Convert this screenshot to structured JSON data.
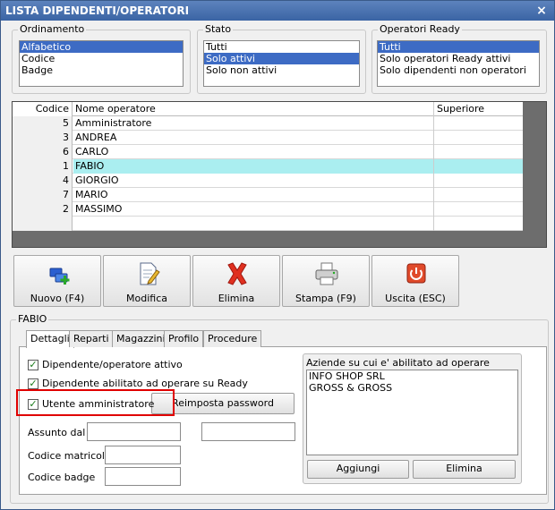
{
  "window": {
    "title": "LISTA DIPENDENTI/OPERATORI",
    "close": "×"
  },
  "ordinamento": {
    "title": "Ordinamento",
    "items": [
      "Alfabetico",
      "Codice",
      "Badge"
    ],
    "selected": 0
  },
  "stato": {
    "title": "Stato",
    "items": [
      "Tutti",
      "Solo attivi",
      "Solo non attivi"
    ],
    "selected": 1
  },
  "operatori_ready": {
    "title": "Operatori Ready",
    "items": [
      "Tutti",
      "Solo operatori Ready attivi",
      "Solo dipendenti non operatori"
    ],
    "selected": 0
  },
  "grid": {
    "headers": {
      "code": "Codice",
      "name": "Nome operatore",
      "superior": "Superiore"
    },
    "rows": [
      {
        "code": "5",
        "name": "Amministratore",
        "superior": ""
      },
      {
        "code": "3",
        "name": "ANDREA",
        "superior": ""
      },
      {
        "code": "6",
        "name": "CARLO",
        "superior": ""
      },
      {
        "code": "1",
        "name": "FABIO",
        "superior": "",
        "selected": true
      },
      {
        "code": "4",
        "name": "GIORGIO",
        "superior": ""
      },
      {
        "code": "7",
        "name": "MARIO",
        "superior": ""
      },
      {
        "code": "2",
        "name": "MASSIMO",
        "superior": ""
      },
      {
        "code": "",
        "name": "",
        "superior": ""
      }
    ]
  },
  "toolbar": {
    "nuovo": "Nuovo (F4)",
    "modifica": "Modifica",
    "elimina": "Elimina",
    "stampa": "Stampa (F9)",
    "uscita": "Uscita (ESC)"
  },
  "detail": {
    "group_title": "FABIO",
    "tabs": [
      "Dettagli",
      "Reparti",
      "Magazzini",
      "Profilo",
      "Procedure"
    ],
    "active_tab": 0,
    "chk_attivo": "Dipendente/operatore attivo",
    "chk_ready": "Dipendente abilitato ad operare su Ready",
    "chk_admin": "Utente amministratore",
    "reset_password": "Reimposta password",
    "assunto_dal": "Assunto dal",
    "codice_matricola": "Codice matricola",
    "codice_badge": "Codice badge",
    "aziende_title": "Aziende su cui e' abilitato ad operare",
    "aziende": [
      "INFO SHOP SRL",
      "GROSS & GROSS"
    ],
    "aggiungi": "Aggiungi",
    "elimina": "Elimina",
    "check_mark": "✓"
  },
  "colors": {
    "highlight_row": "#aaeef0",
    "list_selection": "#3d6bc4",
    "annotation": "#e00000"
  }
}
